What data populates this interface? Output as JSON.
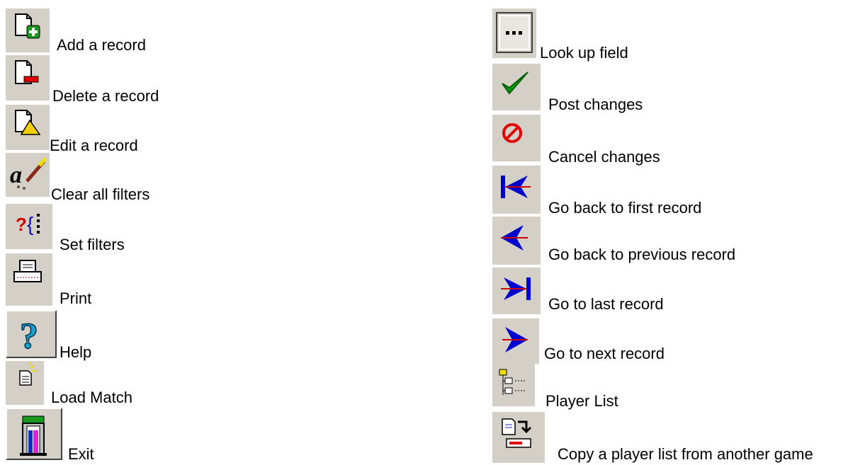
{
  "left_items": [
    {
      "label": "Add a record",
      "icon": "add-record-icon"
    },
    {
      "label": "Delete a record",
      "icon": "delete-record-icon"
    },
    {
      "label": "Edit a record",
      "icon": "edit-record-icon"
    },
    {
      "label": "Clear all filters",
      "icon": "clear-filters-icon"
    },
    {
      "label": "Set filters",
      "icon": "set-filters-icon"
    },
    {
      "label": "Print",
      "icon": "print-icon"
    },
    {
      "label": "Help",
      "icon": "help-icon"
    },
    {
      "label": "Load Match",
      "icon": "load-match-icon"
    },
    {
      "label": "Exit",
      "icon": "exit-icon"
    }
  ],
  "right_items": [
    {
      "label": "Look up field",
      "icon": "ellipsis-icon"
    },
    {
      "label": "Post changes",
      "icon": "checkmark-icon"
    },
    {
      "label": "Cancel changes",
      "icon": "cancel-icon"
    },
    {
      "label": "Go back to first record",
      "icon": "first-record-icon"
    },
    {
      "label": "Go back to previous record",
      "icon": "previous-record-icon"
    },
    {
      "label": "Go to last record",
      "icon": "last-record-icon"
    },
    {
      "label": "Go to next record",
      "icon": "next-record-icon"
    },
    {
      "label": "Player List",
      "icon": "player-list-icon"
    },
    {
      "label": "Copy a player list from another game",
      "icon": "copy-player-list-icon"
    }
  ],
  "colors": {
    "button_face": "#d4d0c8",
    "check_green": "#0a9a0a",
    "cancel_red": "#e00000",
    "nav_blue": "#0000cc",
    "nav_red": "#cc0000"
  }
}
